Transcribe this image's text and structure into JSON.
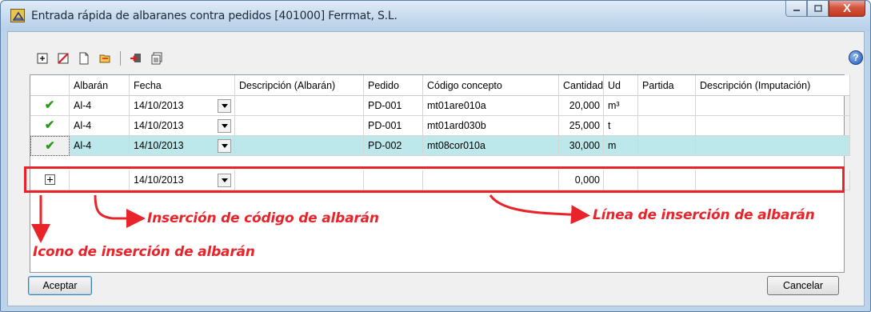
{
  "window": {
    "title": "Entrada rápida de albaranes contra pedidos [401000] Ferrmat, S.L.",
    "controls": {
      "minimize": "minimize-icon",
      "maximize": "maximize-icon",
      "close_label": "X"
    }
  },
  "toolbar": {
    "icons": [
      "add-row-icon",
      "delete-row-icon",
      "new-document-icon",
      "open-document-icon",
      "import-icon",
      "copy-icon"
    ]
  },
  "help": {
    "label": "?"
  },
  "grid": {
    "columns": [
      "",
      "Albarán",
      "Fecha",
      "Descripción (Albarán)",
      "Pedido",
      "Código concepto",
      "Cantidad",
      "Ud",
      "Partida",
      "Descripción (Imputación)"
    ],
    "rows": [
      {
        "status": "✔",
        "albaran": "Al-4",
        "fecha": "14/10/2013",
        "desc_albaran": "",
        "pedido": "PD-001",
        "codigo": "mt01are010a",
        "cantidad": "20,000",
        "ud": "m³",
        "partida": "",
        "desc_imput": ""
      },
      {
        "status": "✔",
        "albaran": "Al-4",
        "fecha": "14/10/2013",
        "desc_albaran": "",
        "pedido": "PD-001",
        "codigo": "mt01ard030b",
        "cantidad": "25,000",
        "ud": "t",
        "partida": "",
        "desc_imput": ""
      },
      {
        "status": "✔",
        "albaran": "Al-4",
        "fecha": "14/10/2013",
        "desc_albaran": "",
        "pedido": "PD-002",
        "codigo": "mt08cor010a",
        "cantidad": "30,000",
        "ud": "m",
        "partida": "",
        "desc_imput": ""
      }
    ],
    "insert_row": {
      "albaran": "",
      "fecha": "14/10/2013",
      "desc_albaran": "",
      "pedido": "",
      "codigo": "",
      "cantidad": "0,000",
      "ud": "",
      "partida": "",
      "desc_imput": ""
    },
    "selected_row_index": 2,
    "selected_row_color": "#bde8eb"
  },
  "annotations": {
    "color": "#e8232a",
    "codigo": "Inserción de código de albarán",
    "linea": "Línea de inserción de albarán",
    "icono": "Icono de inserción de albarán"
  },
  "buttons": {
    "accept": "Aceptar",
    "cancel": "Cancelar"
  }
}
